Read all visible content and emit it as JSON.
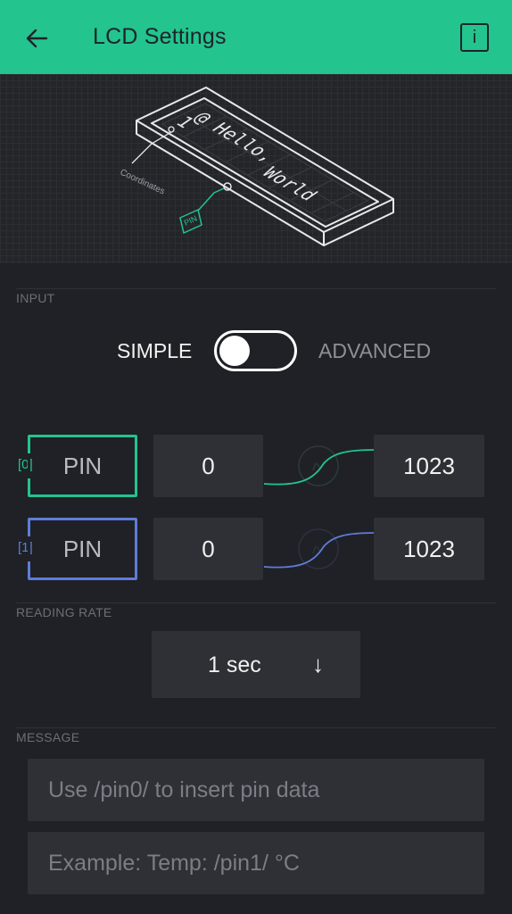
{
  "header": {
    "title": "LCD Settings",
    "back_icon": "arrow-left-icon",
    "info_icon": "info-icon",
    "info_glyph": "i",
    "color": "#23c48e"
  },
  "illustration": {
    "lcd_line1": "@ Hello,",
    "lcd_line2": "World",
    "lcd_row_marker": "1",
    "coordinates_label": "Coordinates",
    "pin_label": "PIN"
  },
  "input": {
    "section_label": "INPUT",
    "mode_left": "SIMPLE",
    "mode_right": "ADVANCED",
    "mode_selected": "SIMPLE"
  },
  "pins": [
    {
      "index": "[0]",
      "label": "PIN",
      "min": "0",
      "max": "1023",
      "color": "#23c48e"
    },
    {
      "index": "[1]",
      "label": "PIN",
      "min": "0",
      "max": "1023",
      "color": "#5f7cd8"
    }
  ],
  "reading_rate": {
    "section_label": "READING RATE",
    "value": "1 sec",
    "arrow": "↓"
  },
  "message": {
    "section_label": "MESSAGE",
    "line1_placeholder": "Use /pin0/ to insert pin data",
    "line2_placeholder": "Example: Temp: /pin1/ °C"
  }
}
